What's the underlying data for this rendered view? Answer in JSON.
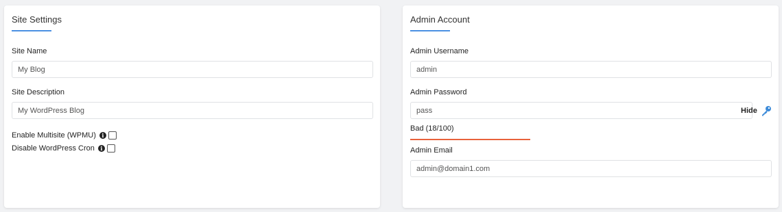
{
  "site_settings": {
    "title": "Site Settings",
    "site_name_label": "Site Name",
    "site_name_value": "My Blog",
    "site_description_label": "Site Description",
    "site_description_value": "My WordPress Blog",
    "multisite_label": "Enable Multisite (WPMU)",
    "multisite_checked": false,
    "disable_cron_label": "Disable WordPress Cron",
    "disable_cron_checked": false,
    "info_glyph": "i"
  },
  "admin_account": {
    "title": "Admin Account",
    "username_label": "Admin Username",
    "username_value": "admin",
    "password_label": "Admin Password",
    "password_value": "pass",
    "hide_label": "Hide",
    "strength_text": "Bad (18/100)",
    "strength_score": 18,
    "strength_max": 100,
    "email_label": "Admin Email",
    "email_value": "admin@domain1.com"
  },
  "colors": {
    "accent": "#4a90e2",
    "strength_bad": "#e8613a",
    "key_icon": "#3d8bd9"
  },
  "icons": {
    "info": "info-icon",
    "key": "key-icon"
  }
}
